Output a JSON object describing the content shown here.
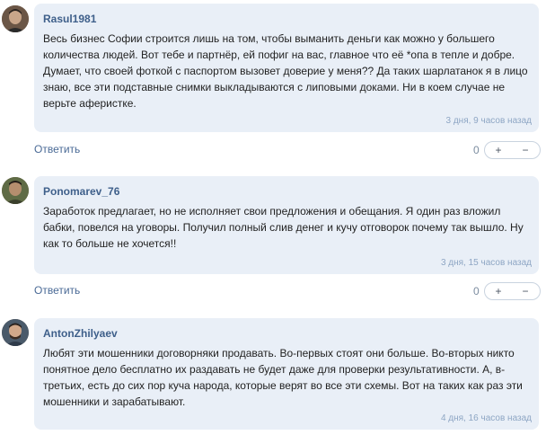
{
  "comments": [
    {
      "author": "Rasul1981",
      "text": "Весь бизнес Софии строится лишь на том, чтобы выманить деньги как можно у большего количества людей. Вот тебе и партнёр, ей пофиг на вас, главное что её *опа в тепле и добре. Думает, что своей фоткой с паспортом вызовет доверие у меня?? Да таких шарлатанок я в лицо знаю, все эти подставные снимки выкладываются с липовыми доками. Ни в коем случае не верьте аферистке.",
      "time": "3 дня, 9 часов назад",
      "reply_label": "Ответить",
      "vote_count": "0",
      "upvote": "+",
      "downvote": "−"
    },
    {
      "author": "Ponomarev_76",
      "text": "Заработок предлагает, но не исполняет свои предложения и обещания. Я один раз вложил бабки, повелся на уговоры. Получил полный слив денег и кучу отговорок почему так вышло. Ну как то больше не хочется!!",
      "time": "3 дня, 15 часов назад",
      "reply_label": "Ответить",
      "vote_count": "0",
      "upvote": "+",
      "downvote": "−"
    },
    {
      "author": "AntonZhilyaev",
      "text": "Любят эти мошенники договорняки продавать. Во-первых стоят они больше. Во-вторых никто понятное дело бесплатно их раздавать не будет даже для проверки результативности. А, в-третьих, есть до сих пор куча народа, которые верят во все эти схемы. Вот на таких как раз эти мошенники и зарабатывают.",
      "time": "4 дня, 16 часов назад"
    }
  ]
}
